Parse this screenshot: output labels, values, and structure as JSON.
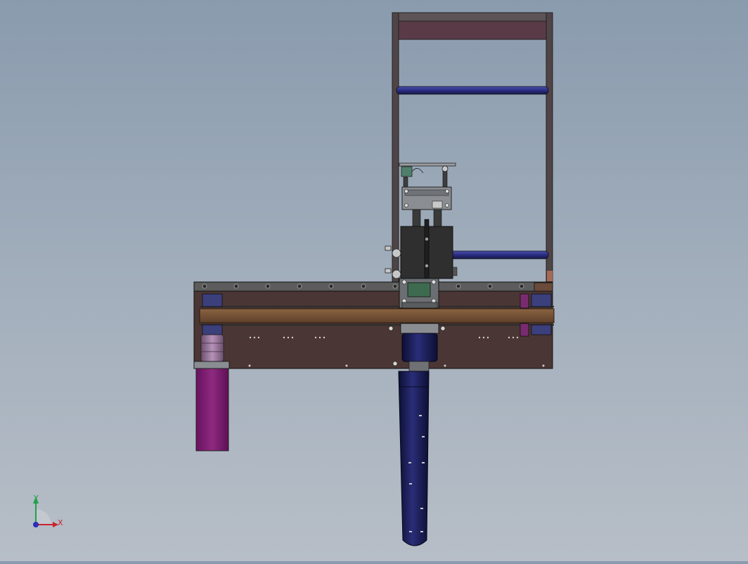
{
  "viewport": {
    "background_top": "#8a9bae",
    "background_bottom": "#b7bec7"
  },
  "triad": {
    "y_label": "Y",
    "x_label": "X",
    "y_color": "#1fa04a",
    "x_color": "#c8232c",
    "origin_color": "#2b2fb8"
  },
  "colors": {
    "frame": "#4a3f3f",
    "plate_top": "#5a3a47",
    "crossbar": "#2c2f86",
    "base_plate": "#4a3634",
    "belt": "#7a5638",
    "motor": "#7a1a6a",
    "cylinder": "#1c1f5a",
    "carriage": "#2f2f2f",
    "steel": "#8a8d91"
  }
}
